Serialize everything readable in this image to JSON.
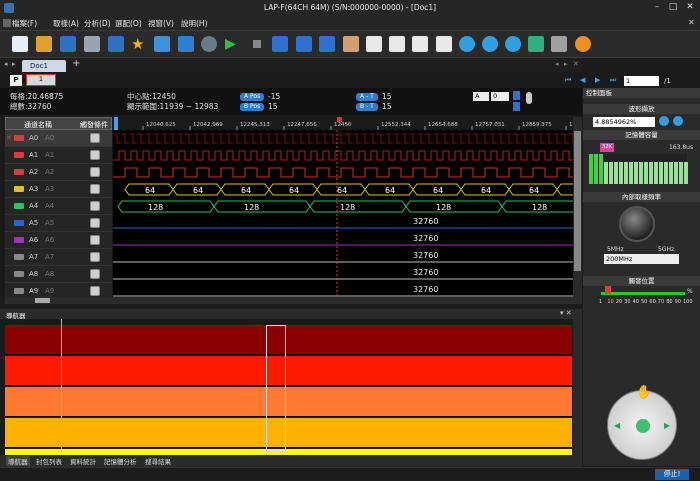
{
  "window": {
    "title": "LAP-F(64CH 64M) (S/N:000000-0000) - [Doc1]"
  },
  "menu": [
    "檔案(F)",
    "取樣(A)",
    "分析(D)",
    "選配(O)",
    "視窗(V)",
    "說明(H)"
  ],
  "tabs": {
    "doc": "Doc1",
    "add": "+"
  },
  "page": {
    "label": "P",
    "current": "1",
    "page_input": "1",
    "page_total": "/1"
  },
  "info": {
    "freq": "每格:20.46875",
    "count": "總數:32760",
    "center": "中心點:12450",
    "range": "顯示範圍:11939 ~ 12983",
    "a_pos_label": "A Pos",
    "a_pos_val": "-15",
    "b_pos_label": "B Pos",
    "b_pos_val": "15",
    "at_label": "A - T",
    "at_val": "15",
    "bt_label": "B - T",
    "bt_val": "15",
    "sel1": "A",
    "sel2": "0"
  },
  "channels": {
    "header_name": "通道名稱",
    "header_trigger": "觸發條件",
    "rows": [
      {
        "name": "A0",
        "alias": "A0",
        "color": "#d04040"
      },
      {
        "name": "A1",
        "alias": "A1",
        "color": "#d04040"
      },
      {
        "name": "A2",
        "alias": "A2",
        "color": "#d04040"
      },
      {
        "name": "A3",
        "alias": "A3",
        "color": "#e0c020"
      },
      {
        "name": "A4",
        "alias": "A4",
        "color": "#30c060"
      },
      {
        "name": "A5",
        "alias": "A5",
        "color": "#3060d0"
      },
      {
        "name": "A6",
        "alias": "A6",
        "color": "#a030c0"
      },
      {
        "name": "A7",
        "alias": "A7",
        "color": "#888888"
      },
      {
        "name": "A8",
        "alias": "A8",
        "color": "#888888"
      },
      {
        "name": "A9",
        "alias": "A9",
        "color": "#888888"
      }
    ]
  },
  "ruler": [
    "12040.625",
    "12042.969",
    "12245.313",
    "12247.656",
    "12450",
    "12552.344",
    "12654.688",
    "12757.031",
    "12859.375",
    "12961.719"
  ],
  "bus": {
    "a3": "64",
    "a4": "128",
    "value": "32760"
  },
  "navigator": {
    "title": "導航器"
  },
  "bottom_tabs": [
    "導航器",
    "封包列表",
    "資料統計",
    "記憶體分析",
    "搜尋結果"
  ],
  "panel": {
    "title": "控制面板",
    "waveform": "波形擷放",
    "zoom": "4.8854962%",
    "memory": "記憶體容量",
    "mem_start": "32K",
    "mem_time": "163.8us",
    "rate": "內部取樣頻率",
    "rate_min": "5MHz",
    "rate_max": "5GHz",
    "rate_value": "200MHz",
    "trigger_pos": "觸發位置",
    "scale": [
      "1",
      "10",
      "20",
      "30",
      "40",
      "50",
      "60",
      "70",
      "80",
      "90",
      "100"
    ],
    "pct": "%"
  },
  "status": {
    "stop": "停止!"
  },
  "nav_colors": [
    "#8b0000",
    "#ff1a00",
    "#ff7a30",
    "#ffb000",
    "#ffff00"
  ]
}
